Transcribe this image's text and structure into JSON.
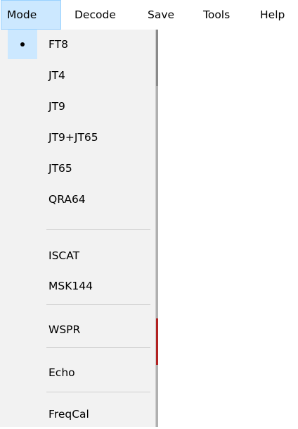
{
  "menubar": {
    "items": [
      {
        "label": "Mode"
      },
      {
        "label": "Decode"
      },
      {
        "label": "Save"
      },
      {
        "label": "Tools"
      },
      {
        "label": "Help"
      }
    ]
  },
  "mode_menu": {
    "groups": [
      {
        "items": [
          {
            "label": "FT8",
            "checked": true
          },
          {
            "label": "JT4"
          },
          {
            "label": "JT9"
          },
          {
            "label": "JT9+JT65"
          },
          {
            "label": "JT65"
          },
          {
            "label": "QRA64"
          }
        ]
      },
      {
        "items": [
          {
            "label": "ISCAT"
          },
          {
            "label": "MSK144"
          }
        ]
      },
      {
        "items": [
          {
            "label": "WSPR"
          }
        ]
      },
      {
        "items": [
          {
            "label": "Echo"
          }
        ]
      },
      {
        "items": [
          {
            "label": "FreqCal"
          }
        ]
      }
    ]
  },
  "colors": {
    "menu_background": "#f2f2f2",
    "highlight": "#cce8ff",
    "highlight_border": "#99d1ff",
    "separator": "#d0d0d0"
  }
}
